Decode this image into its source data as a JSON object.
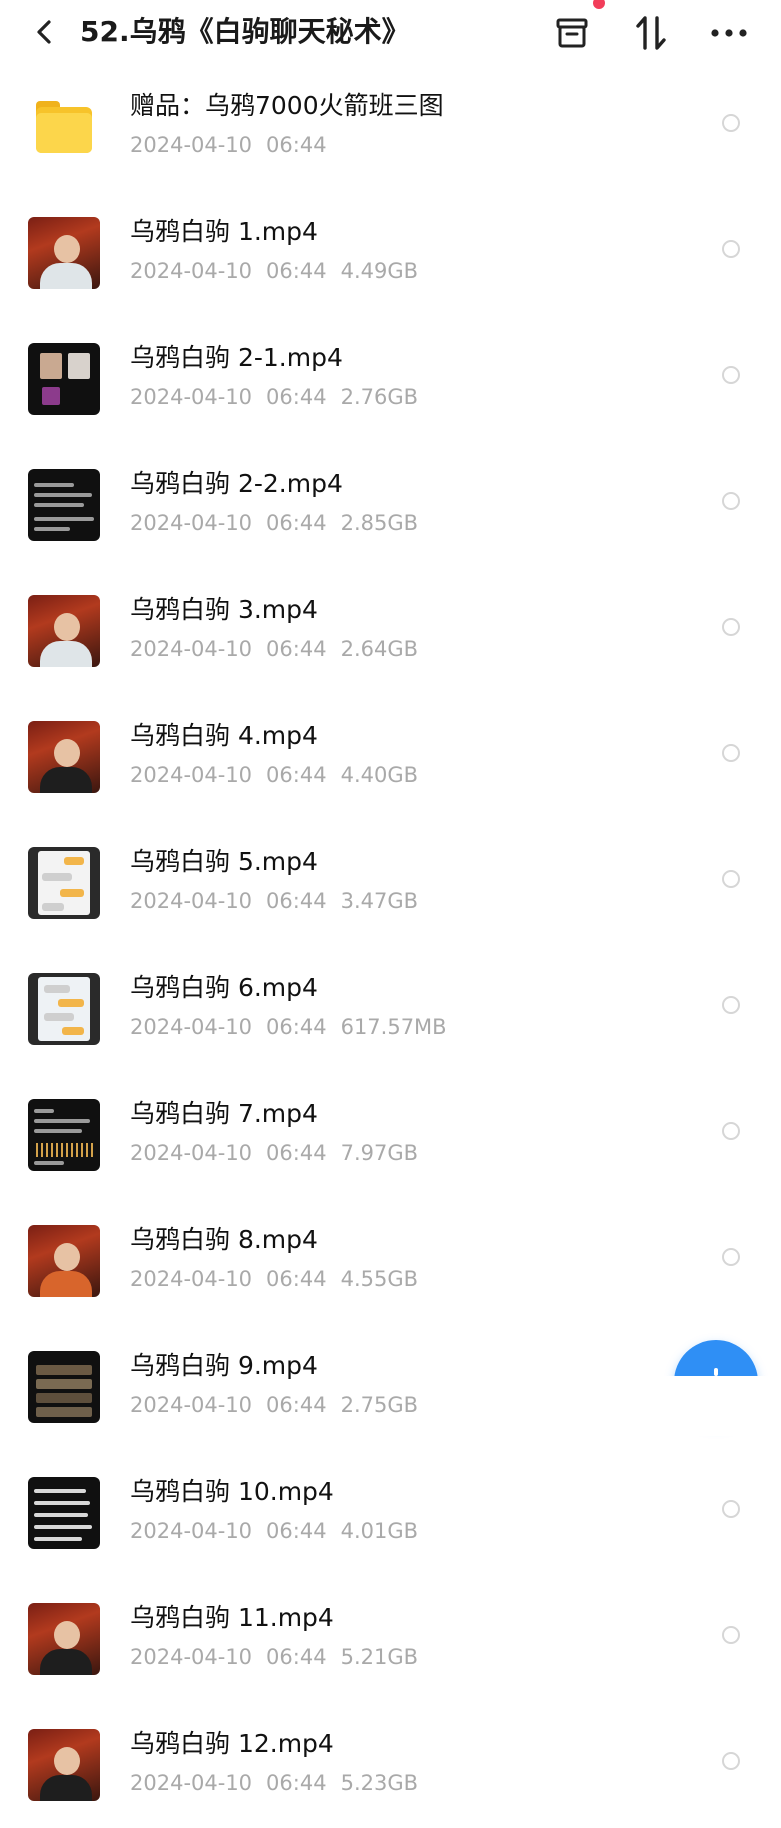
{
  "header": {
    "title": "52.乌鸦《白驹聊天秘术》",
    "icons": {
      "back": "chevron-left-icon",
      "archive": "archive-box-icon",
      "sort": "sort-arrows-icon",
      "more": "more-dots-icon"
    }
  },
  "files": [
    {
      "name": "赠品：乌鸦7000火箭班三图",
      "date": "2024-04-10",
      "time": "06:44",
      "size": "",
      "kind": "folder"
    },
    {
      "name": "乌鸦白驹 1.mp4",
      "date": "2024-04-10",
      "time": "06:44",
      "size": "4.49GB",
      "kind": "person"
    },
    {
      "name": "乌鸦白驹 2-1.mp4",
      "date": "2024-04-10",
      "time": "06:44",
      "size": "2.76GB",
      "kind": "dark"
    },
    {
      "name": "乌鸦白驹 2-2.mp4",
      "date": "2024-04-10",
      "time": "06:44",
      "size": "2.85GB",
      "kind": "dark"
    },
    {
      "name": "乌鸦白驹 3.mp4",
      "date": "2024-04-10",
      "time": "06:44",
      "size": "2.64GB",
      "kind": "person"
    },
    {
      "name": "乌鸦白驹 4.mp4",
      "date": "2024-04-10",
      "time": "06:44",
      "size": "4.40GB",
      "kind": "person-dark"
    },
    {
      "name": "乌鸦白驹 5.mp4",
      "date": "2024-04-10",
      "time": "06:44",
      "size": "3.47GB",
      "kind": "chat"
    },
    {
      "name": "乌鸦白驹 6.mp4",
      "date": "2024-04-10",
      "time": "06:44",
      "size": "617.57MB",
      "kind": "chat"
    },
    {
      "name": "乌鸦白驹 7.mp4",
      "date": "2024-04-10",
      "time": "06:44",
      "size": "7.97GB",
      "kind": "dark"
    },
    {
      "name": "乌鸦白驹 8.mp4",
      "date": "2024-04-10",
      "time": "06:44",
      "size": "4.55GB",
      "kind": "person-orange"
    },
    {
      "name": "乌鸦白驹 9.mp4",
      "date": "2024-04-10",
      "time": "06:44",
      "size": "2.75GB",
      "kind": "dark"
    },
    {
      "name": "乌鸦白驹 10.mp4",
      "date": "2024-04-10",
      "time": "06:44",
      "size": "4.01GB",
      "kind": "dark"
    },
    {
      "name": "乌鸦白驹 11.mp4",
      "date": "2024-04-10",
      "time": "06:44",
      "size": "5.21GB",
      "kind": "person-dark"
    },
    {
      "name": "乌鸦白驹 12.mp4",
      "date": "2024-04-10",
      "time": "06:44",
      "size": "5.23GB",
      "kind": "person-dark"
    }
  ],
  "colors": {
    "fab": "#2f8ff5",
    "notify_dot": "#f23d5a",
    "folder": "#fcd64b",
    "meta_text": "#a9a9a9"
  }
}
